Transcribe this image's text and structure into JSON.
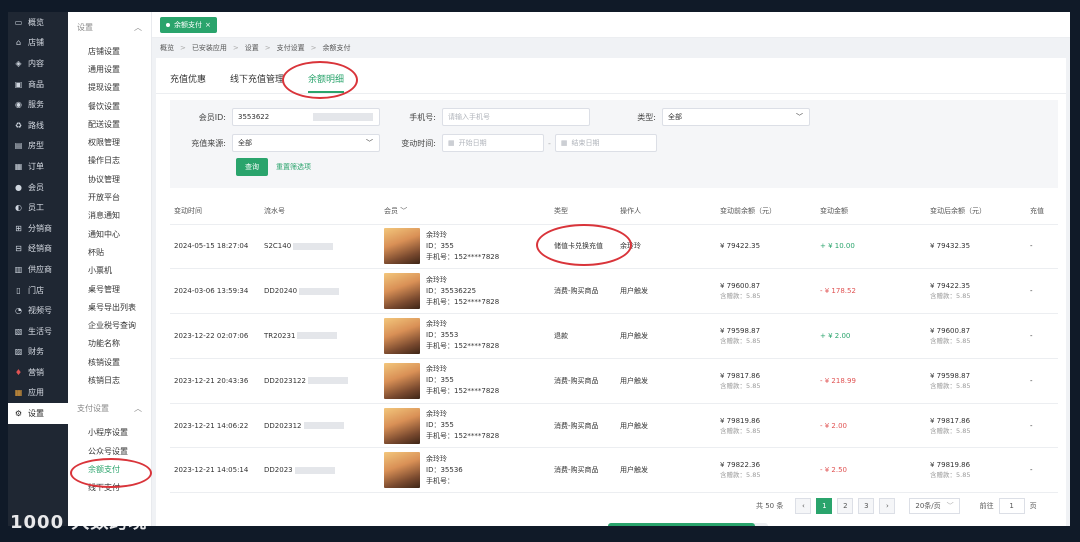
{
  "nav": [
    "概览",
    "店铺",
    "内容",
    "商品",
    "服务",
    "路线",
    "房型",
    "订单",
    "会员",
    "员工",
    "分销商",
    "经销商",
    "供应商",
    "门店",
    "视频号",
    "生活号",
    "财务",
    "营销",
    "应用",
    "设置"
  ],
  "nav_active": 19,
  "sub": {
    "group1": "设置",
    "items1": [
      "店铺设置",
      "通用设置",
      "提现设置",
      "餐饮设置",
      "配送设置",
      "权限管理",
      "操作日志",
      "协议管理",
      "开放平台",
      "消息通知",
      "通知中心",
      "杯贴",
      "小票机",
      "桌号管理",
      "桌号导出列表",
      "企业税号查询",
      "功能名称",
      "核销设置",
      "核销日志"
    ],
    "group2": "支付设置",
    "items2": [
      "小程序设置",
      "公众号设置",
      "余额支付",
      "线下支付"
    ],
    "active": "余额支付"
  },
  "tag": "余额支付",
  "crumb": [
    "概览",
    "已安装应用",
    "设置",
    "支付设置",
    "余额支付"
  ],
  "tabs": [
    "充值优惠",
    "线下充值管理",
    "余额明细"
  ],
  "active_tab": 2,
  "filters": {
    "member_label": "会员ID:",
    "member_value": "3553622",
    "phone_label": "手机号:",
    "phone_placeholder": "请输入手机号",
    "type_label": "类型:",
    "type_value": "全部",
    "source_label": "充值来源:",
    "source_value": "全部",
    "time_label": "变动时间:",
    "start_placeholder": "开始日期",
    "end_placeholder": "结束日期",
    "query": "查询",
    "reset": "重置筛选项"
  },
  "columns": [
    "变动时间",
    "流水号",
    "会员",
    "类型",
    "操作人",
    "变动前余额（元）",
    "变动金额",
    "变动后余额（元）",
    "充值"
  ],
  "rows": [
    {
      "time": "2024-05-15 18:27:04",
      "sn": "S2C140",
      "name": "余玲玲",
      "id": "ID：355",
      "phone": "手机号：152****7828",
      "type": "储值卡兑换充值",
      "op": "余玲玲",
      "before": "¥ 79422.35",
      "before_sub": "",
      "amount": "+ ¥ 10.00",
      "amount_pos": true,
      "after": "¥ 79432.35",
      "after_sub": "",
      "extra": "-"
    },
    {
      "time": "2024-03-06 13:59:34",
      "sn": "DD20240",
      "name": "余玲玲",
      "id": "ID：35536225",
      "phone": "手机号：152****7828",
      "type": "消费-购买商品",
      "op": "用户触发",
      "before": "¥ 79600.87",
      "before_sub": "含赠款：5.85",
      "amount": "- ¥ 178.52",
      "amount_pos": false,
      "after": "¥ 79422.35",
      "after_sub": "含赠款：5.85",
      "extra": "-"
    },
    {
      "time": "2023-12-22 02:07:06",
      "sn": "TR20231",
      "name": "余玲玲",
      "id": "ID：3553",
      "phone": "手机号：152****7828",
      "type": "退款",
      "op": "用户触发",
      "before": "¥ 79598.87",
      "before_sub": "含赠款：5.85",
      "amount": "+ ¥ 2.00",
      "amount_pos": true,
      "after": "¥ 79600.87",
      "after_sub": "含赠款：5.85",
      "extra": "-"
    },
    {
      "time": "2023-12-21 20:43:36",
      "sn": "DD2023122",
      "name": "余玲玲",
      "id": "ID：355",
      "phone": "手机号：152****7828",
      "type": "消费-购买商品",
      "op": "用户触发",
      "before": "¥ 79817.86",
      "before_sub": "含赠款：5.85",
      "amount": "- ¥ 218.99",
      "amount_pos": false,
      "after": "¥ 79598.87",
      "after_sub": "含赠款：5.85",
      "extra": "-"
    },
    {
      "time": "2023-12-21 14:06:22",
      "sn": "DD202312",
      "name": "余玲玲",
      "id": "ID：355",
      "phone": "手机号：152****7828",
      "type": "消费-购买商品",
      "op": "用户触发",
      "before": "¥ 79819.86",
      "before_sub": "含赠款：5.85",
      "amount": "- ¥ 2.00",
      "amount_pos": false,
      "after": "¥ 79817.86",
      "after_sub": "含赠款：5.85",
      "extra": "-"
    },
    {
      "time": "2023-12-21 14:05:14",
      "sn": "DD2023",
      "name": "余玲玲",
      "id": "ID：35536",
      "phone": "手机号：",
      "type": "消费-购买商品",
      "op": "用户触发",
      "before": "¥ 79822.36",
      "before_sub": "含赠款：5.85",
      "amount": "- ¥ 2.50",
      "amount_pos": false,
      "after": "¥ 79819.86",
      "after_sub": "含赠款：5.85",
      "extra": "-"
    }
  ],
  "pager": {
    "total": "共 50 条",
    "pages": [
      "1",
      "2",
      "3"
    ],
    "size": "20条/页",
    "goto": "前往",
    "goto_value": "1",
    "page_unit": "页"
  },
  "watermark": "1000 大数跨境",
  "colors": {
    "accent": "#2aa46c",
    "negative": "#e05353",
    "annotation": "#d9343a"
  }
}
